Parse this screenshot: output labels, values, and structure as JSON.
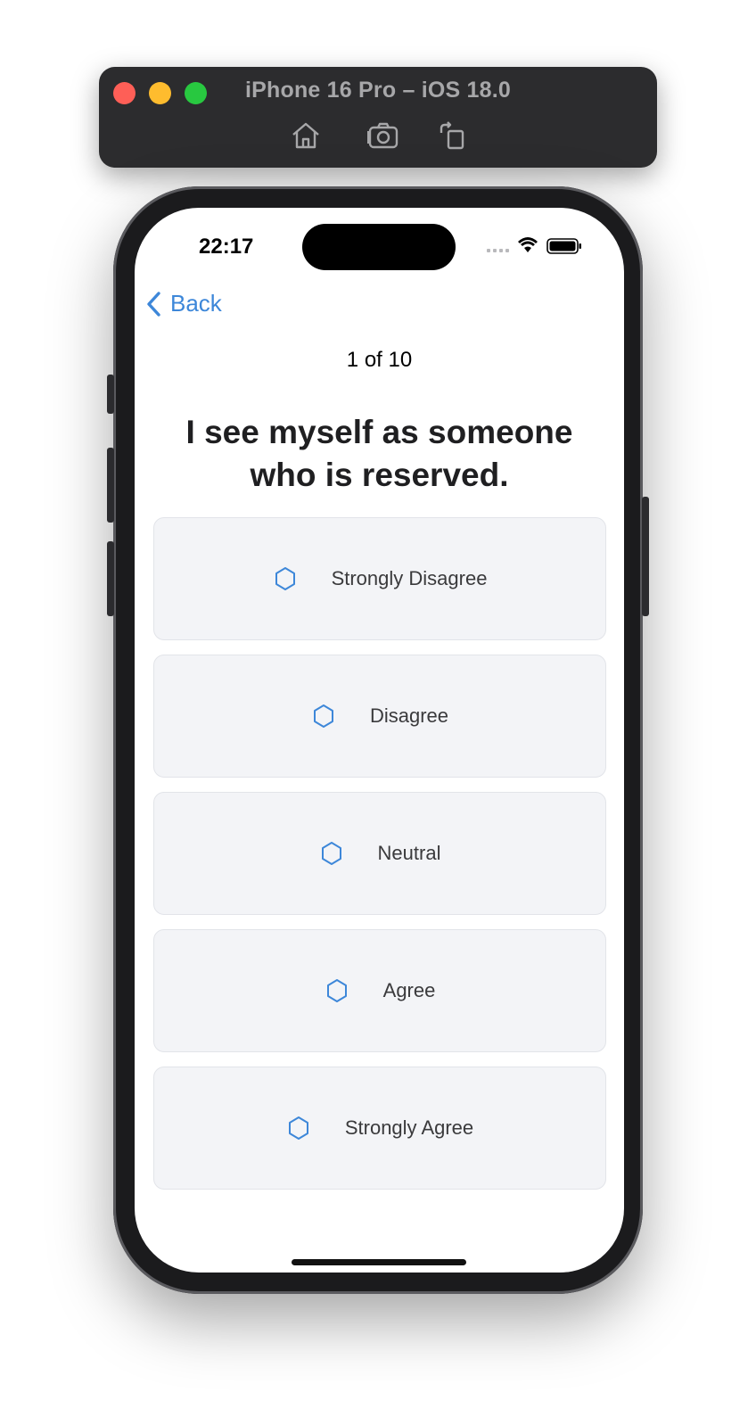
{
  "simulator": {
    "title": "iPhone 16 Pro – iOS 18.0",
    "tools": [
      {
        "icon": "home-icon"
      },
      {
        "icon": "screenshot-camera-icon"
      },
      {
        "icon": "rotate-icon"
      }
    ]
  },
  "status_bar": {
    "time": "22:17",
    "icons": [
      "cellular-icon",
      "wifi-icon",
      "battery-icon"
    ]
  },
  "nav": {
    "back_label": "Back"
  },
  "quiz": {
    "progress": "1 of 10",
    "question": "I see myself as someone who is reserved.",
    "options": [
      {
        "label": "Strongly Disagree",
        "icon": "hexagon-icon"
      },
      {
        "label": "Disagree",
        "icon": "hexagon-icon"
      },
      {
        "label": "Neutral",
        "icon": "hexagon-icon"
      },
      {
        "label": "Agree",
        "icon": "hexagon-icon"
      },
      {
        "label": "Strongly Agree",
        "icon": "hexagon-icon"
      }
    ]
  },
  "colors": {
    "accent": "#3d87d9",
    "option_background": "#f3f4f7",
    "toolbar_background": "#2c2c2e"
  }
}
